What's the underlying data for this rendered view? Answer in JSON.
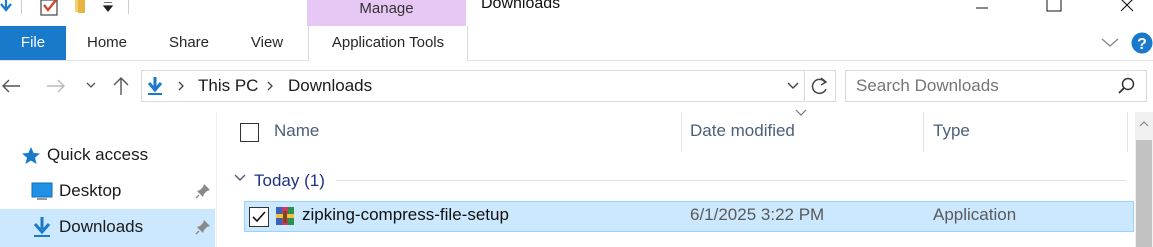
{
  "titlebar": {
    "context_tab": "Manage",
    "window_title": "Downloads"
  },
  "ribbon": {
    "tabs": [
      "File",
      "Home",
      "Share",
      "View",
      "Application Tools"
    ]
  },
  "address": {
    "crumbs": [
      "This PC",
      "Downloads"
    ],
    "search_placeholder": "Search Downloads"
  },
  "nav": {
    "items": [
      {
        "label": "Quick access",
        "icon": "star-icon"
      },
      {
        "label": "Desktop",
        "icon": "desktop-icon",
        "pinned": true
      },
      {
        "label": "Downloads",
        "icon": "download-arrow-icon",
        "pinned": true,
        "selected": true
      }
    ]
  },
  "list": {
    "columns": [
      "Name",
      "Date modified",
      "Type"
    ],
    "group": "Today (1)",
    "rows": [
      {
        "name": "zipking-compress-file-setup",
        "date": "6/1/2025 3:22 PM",
        "type": "Application",
        "selected": true,
        "checked": true
      }
    ]
  },
  "colors": {
    "accent": "#1979ca",
    "manage_tab": "#e7c7f4",
    "selection": "#cce8ff",
    "selection_border": "#99d1ff"
  }
}
